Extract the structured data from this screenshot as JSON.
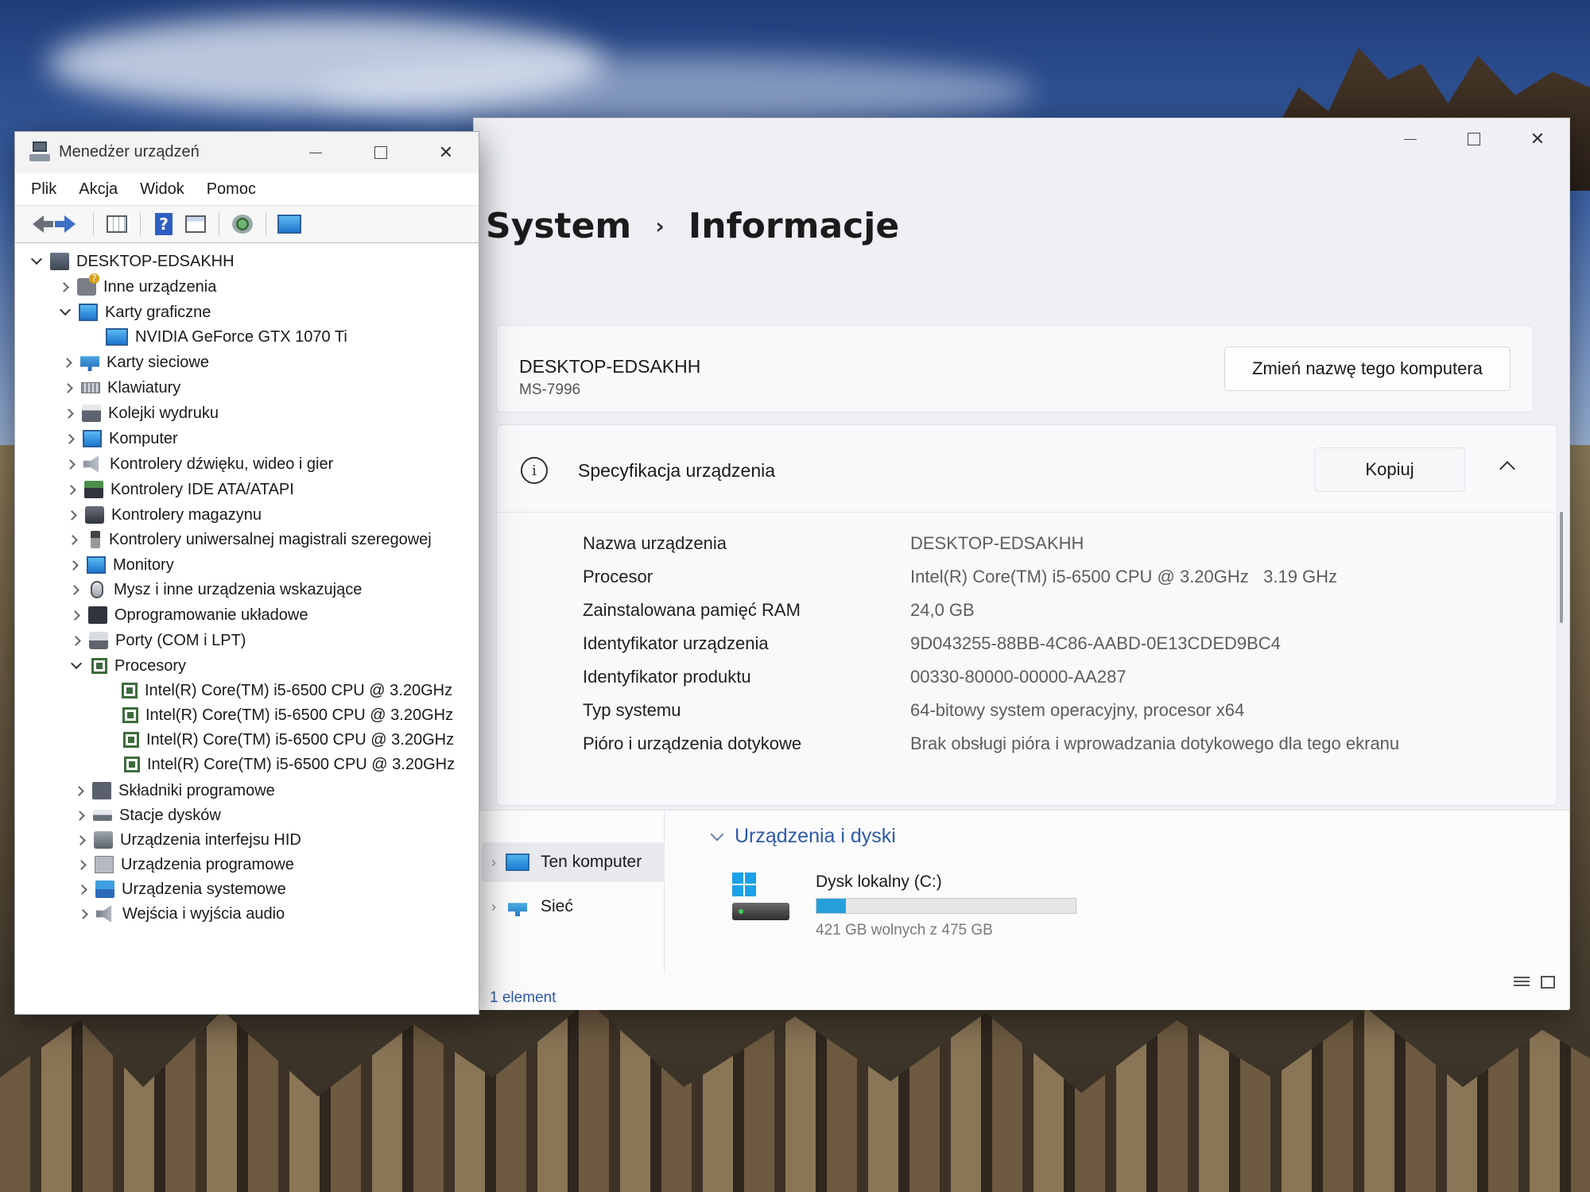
{
  "settings": {
    "breadcrumb_root": "System",
    "breadcrumb_sep": "›",
    "breadcrumb_page": "Informacje",
    "device_name": "DESKTOP-EDSAKHH",
    "device_model": "MS-7996",
    "rename_button": "Zmień nazwę tego komputera",
    "spec_title": "Specyfikacja urządzenia",
    "copy_button": "Kopiuj",
    "specs": [
      {
        "label": "Nazwa urządzenia",
        "value": "DESKTOP-EDSAKHH"
      },
      {
        "label": "Procesor",
        "value": "Intel(R) Core(TM) i5-6500 CPU @ 3.20GHz   3.19 GHz"
      },
      {
        "label": "Zainstalowana pamięć RAM",
        "value": "24,0 GB"
      },
      {
        "label": "Identyfikator urządzenia",
        "value": "9D043255-88BB-4C86-AABD-0E13CDED9BC4"
      },
      {
        "label": "Identyfikator produktu",
        "value": "00330-80000-00000-AA287"
      },
      {
        "label": "Typ systemu",
        "value": "64-bitowy system operacyjny, procesor x64"
      },
      {
        "label": "Pióro i urządzenia dotykowe",
        "value": "Brak obsługi pióra i wprowadzania dotykowego dla tego ekranu"
      }
    ]
  },
  "explorer": {
    "nav_this_pc": "Ten komputer",
    "nav_network": "Sieć",
    "group_title": "Urządzenia i dyski",
    "drive_name": "Dysk lokalny (C:)",
    "drive_free": "421 GB wolnych z 475 GB",
    "drive_used_fraction": 0.114,
    "status_count": "1 element"
  },
  "devmgr": {
    "title": "Menedżer urządzeń",
    "menu": [
      "Plik",
      "Akcja",
      "Widok",
      "Pomoc"
    ],
    "root": "DESKTOP-EDSAKHH",
    "categories": [
      "Inne urządzenia",
      "Karty graficzne",
      "NVIDIA GeForce GTX 1070 Ti",
      "Karty sieciowe",
      "Klawiatury",
      "Kolejki wydruku",
      "Komputer",
      "Kontrolery dźwięku, wideo i gier",
      "Kontrolery IDE ATA/ATAPI",
      "Kontrolery magazynu",
      "Kontrolery uniwersalnej magistrali szeregowej",
      "Monitory",
      "Mysz i inne urządzenia wskazujące",
      "Oprogramowanie układowe",
      "Porty (COM i LPT)",
      "Procesory",
      "Intel(R) Core(TM) i5-6500 CPU @ 3.20GHz",
      "Intel(R) Core(TM) i5-6500 CPU @ 3.20GHz",
      "Intel(R) Core(TM) i5-6500 CPU @ 3.20GHz",
      "Intel(R) Core(TM) i5-6500 CPU @ 3.20GHz",
      "Składniki programowe",
      "Stacje dysków",
      "Urządzenia interfejsu HID",
      "Urządzenia programowe",
      "Urządzenia systemowe",
      "Wejścia i wyjścia audio"
    ]
  },
  "colors": {
    "accent": "#26a0da",
    "link": "#2f5aa8"
  },
  "icons": {
    "devmgr_app": "device-manager-icon",
    "info": "info-icon",
    "drive": "local-disk-icon"
  }
}
